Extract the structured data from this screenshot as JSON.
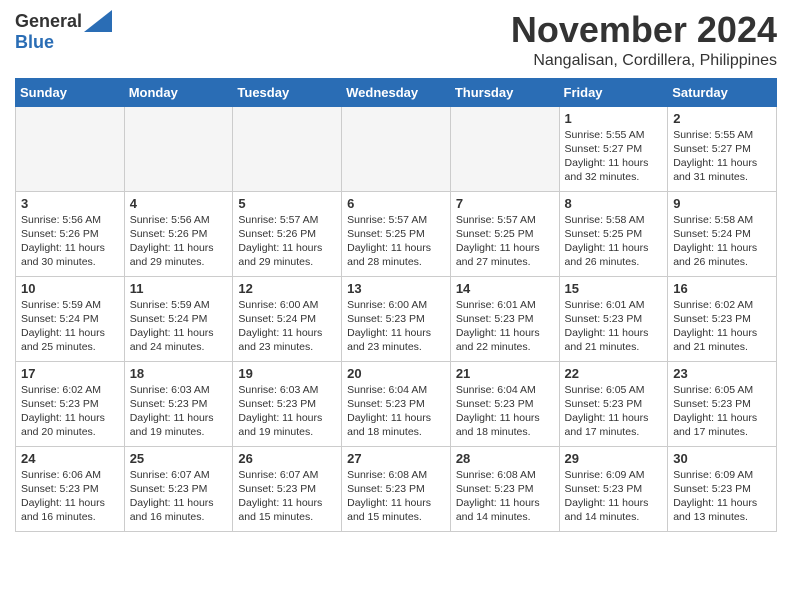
{
  "header": {
    "logo_general": "General",
    "logo_blue": "Blue",
    "month_year": "November 2024",
    "location": "Nangalisan, Cordillera, Philippines"
  },
  "days_of_week": [
    "Sunday",
    "Monday",
    "Tuesday",
    "Wednesday",
    "Thursday",
    "Friday",
    "Saturday"
  ],
  "weeks": [
    [
      {
        "day": "",
        "info": ""
      },
      {
        "day": "",
        "info": ""
      },
      {
        "day": "",
        "info": ""
      },
      {
        "day": "",
        "info": ""
      },
      {
        "day": "",
        "info": ""
      },
      {
        "day": "1",
        "info": "Sunrise: 5:55 AM\nSunset: 5:27 PM\nDaylight: 11 hours\nand 32 minutes."
      },
      {
        "day": "2",
        "info": "Sunrise: 5:55 AM\nSunset: 5:27 PM\nDaylight: 11 hours\nand 31 minutes."
      }
    ],
    [
      {
        "day": "3",
        "info": "Sunrise: 5:56 AM\nSunset: 5:26 PM\nDaylight: 11 hours\nand 30 minutes."
      },
      {
        "day": "4",
        "info": "Sunrise: 5:56 AM\nSunset: 5:26 PM\nDaylight: 11 hours\nand 29 minutes."
      },
      {
        "day": "5",
        "info": "Sunrise: 5:57 AM\nSunset: 5:26 PM\nDaylight: 11 hours\nand 29 minutes."
      },
      {
        "day": "6",
        "info": "Sunrise: 5:57 AM\nSunset: 5:25 PM\nDaylight: 11 hours\nand 28 minutes."
      },
      {
        "day": "7",
        "info": "Sunrise: 5:57 AM\nSunset: 5:25 PM\nDaylight: 11 hours\nand 27 minutes."
      },
      {
        "day": "8",
        "info": "Sunrise: 5:58 AM\nSunset: 5:25 PM\nDaylight: 11 hours\nand 26 minutes."
      },
      {
        "day": "9",
        "info": "Sunrise: 5:58 AM\nSunset: 5:24 PM\nDaylight: 11 hours\nand 26 minutes."
      }
    ],
    [
      {
        "day": "10",
        "info": "Sunrise: 5:59 AM\nSunset: 5:24 PM\nDaylight: 11 hours\nand 25 minutes."
      },
      {
        "day": "11",
        "info": "Sunrise: 5:59 AM\nSunset: 5:24 PM\nDaylight: 11 hours\nand 24 minutes."
      },
      {
        "day": "12",
        "info": "Sunrise: 6:00 AM\nSunset: 5:24 PM\nDaylight: 11 hours\nand 23 minutes."
      },
      {
        "day": "13",
        "info": "Sunrise: 6:00 AM\nSunset: 5:23 PM\nDaylight: 11 hours\nand 23 minutes."
      },
      {
        "day": "14",
        "info": "Sunrise: 6:01 AM\nSunset: 5:23 PM\nDaylight: 11 hours\nand 22 minutes."
      },
      {
        "day": "15",
        "info": "Sunrise: 6:01 AM\nSunset: 5:23 PM\nDaylight: 11 hours\nand 21 minutes."
      },
      {
        "day": "16",
        "info": "Sunrise: 6:02 AM\nSunset: 5:23 PM\nDaylight: 11 hours\nand 21 minutes."
      }
    ],
    [
      {
        "day": "17",
        "info": "Sunrise: 6:02 AM\nSunset: 5:23 PM\nDaylight: 11 hours\nand 20 minutes."
      },
      {
        "day": "18",
        "info": "Sunrise: 6:03 AM\nSunset: 5:23 PM\nDaylight: 11 hours\nand 19 minutes."
      },
      {
        "day": "19",
        "info": "Sunrise: 6:03 AM\nSunset: 5:23 PM\nDaylight: 11 hours\nand 19 minutes."
      },
      {
        "day": "20",
        "info": "Sunrise: 6:04 AM\nSunset: 5:23 PM\nDaylight: 11 hours\nand 18 minutes."
      },
      {
        "day": "21",
        "info": "Sunrise: 6:04 AM\nSunset: 5:23 PM\nDaylight: 11 hours\nand 18 minutes."
      },
      {
        "day": "22",
        "info": "Sunrise: 6:05 AM\nSunset: 5:23 PM\nDaylight: 11 hours\nand 17 minutes."
      },
      {
        "day": "23",
        "info": "Sunrise: 6:05 AM\nSunset: 5:23 PM\nDaylight: 11 hours\nand 17 minutes."
      }
    ],
    [
      {
        "day": "24",
        "info": "Sunrise: 6:06 AM\nSunset: 5:23 PM\nDaylight: 11 hours\nand 16 minutes."
      },
      {
        "day": "25",
        "info": "Sunrise: 6:07 AM\nSunset: 5:23 PM\nDaylight: 11 hours\nand 16 minutes."
      },
      {
        "day": "26",
        "info": "Sunrise: 6:07 AM\nSunset: 5:23 PM\nDaylight: 11 hours\nand 15 minutes."
      },
      {
        "day": "27",
        "info": "Sunrise: 6:08 AM\nSunset: 5:23 PM\nDaylight: 11 hours\nand 15 minutes."
      },
      {
        "day": "28",
        "info": "Sunrise: 6:08 AM\nSunset: 5:23 PM\nDaylight: 11 hours\nand 14 minutes."
      },
      {
        "day": "29",
        "info": "Sunrise: 6:09 AM\nSunset: 5:23 PM\nDaylight: 11 hours\nand 14 minutes."
      },
      {
        "day": "30",
        "info": "Sunrise: 6:09 AM\nSunset: 5:23 PM\nDaylight: 11 hours\nand 13 minutes."
      }
    ]
  ]
}
